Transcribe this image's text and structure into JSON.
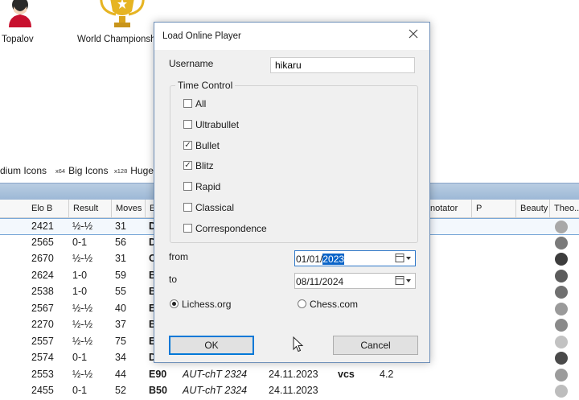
{
  "background_app": {
    "icons": [
      {
        "label": "Topalov",
        "icon": "player-avatar-icon"
      },
      {
        "label": "World Championsh",
        "icon": "trophy-icon"
      }
    ],
    "size_options": [
      {
        "multiplier": "",
        "label": "dium Icons"
      },
      {
        "multiplier": "x64",
        "label": "Big Icons"
      },
      {
        "multiplier": "x128",
        "label": "Huge"
      }
    ],
    "grid": {
      "columns": [
        "Elo B",
        "Result",
        "Moves",
        "E",
        "notator",
        "P",
        "Beauty",
        "Theo..."
      ],
      "rows": [
        {
          "elo_b": "2421",
          "result": "½-½",
          "moves": "31",
          "eco": "D",
          "dot": "#a8a8a8"
        },
        {
          "elo_b": "2565",
          "result": "0-1",
          "moves": "56",
          "eco": "D",
          "dot": "#7a7a7a"
        },
        {
          "elo_b": "2670",
          "result": "½-½",
          "moves": "31",
          "eco": "C",
          "dot": "#3d3d3d"
        },
        {
          "elo_b": "2624",
          "result": "1-0",
          "moves": "59",
          "eco": "B",
          "dot": "#5c5c5c"
        },
        {
          "elo_b": "2538",
          "result": "1-0",
          "moves": "55",
          "eco": "B",
          "dot": "#707070"
        },
        {
          "elo_b": "2567",
          "result": "½-½",
          "moves": "40",
          "eco": "E",
          "dot": "#9a9a9a"
        },
        {
          "elo_b": "2270",
          "result": "½-½",
          "moves": "37",
          "eco": "B",
          "dot": "#8a8a8a"
        },
        {
          "elo_b": "2557",
          "result": "½-½",
          "moves": "75",
          "eco": "E",
          "dot": "#c2c2c2"
        },
        {
          "elo_b": "2574",
          "result": "0-1",
          "moves": "34",
          "eco": "D",
          "dot": "#4a4a4a"
        },
        {
          "elo_b": "2553",
          "result": "½-½",
          "moves": "44",
          "eco": "E90",
          "event": "AUT-chT 2324",
          "date": "24.11.2023",
          "annotator": "vcs",
          "extra": "4.2",
          "dot": "#9c9c9c"
        },
        {
          "elo_b": "2455",
          "result": "0-1",
          "moves": "52",
          "eco": "B50",
          "event": "AUT-chT 2324",
          "date": "24.11.2023",
          "annotator": "",
          "extra": "",
          "dot": "#bdbdbd"
        }
      ]
    }
  },
  "dialog": {
    "title": "Load Online Player",
    "close_icon": "close-icon",
    "username_label": "Username",
    "username_value": "hikaru",
    "time_control": {
      "legend": "Time Control",
      "options": [
        {
          "label": "All",
          "checked": false
        },
        {
          "label": "Ultrabullet",
          "checked": false
        },
        {
          "label": "Bullet",
          "checked": true
        },
        {
          "label": "Blitz",
          "checked": true
        },
        {
          "label": "Rapid",
          "checked": false
        },
        {
          "label": "Classical",
          "checked": false
        },
        {
          "label": "Correspondence",
          "checked": false
        }
      ]
    },
    "from_label": "from",
    "from_date_prefix": "01/01/",
    "from_date_selected": "2023",
    "to_label": "to",
    "to_date": "08/11/2024",
    "sources": [
      {
        "label": "Lichess.org",
        "selected": true
      },
      {
        "label": "Chess.com",
        "selected": false
      }
    ],
    "ok_label": "OK",
    "cancel_label": "Cancel"
  }
}
